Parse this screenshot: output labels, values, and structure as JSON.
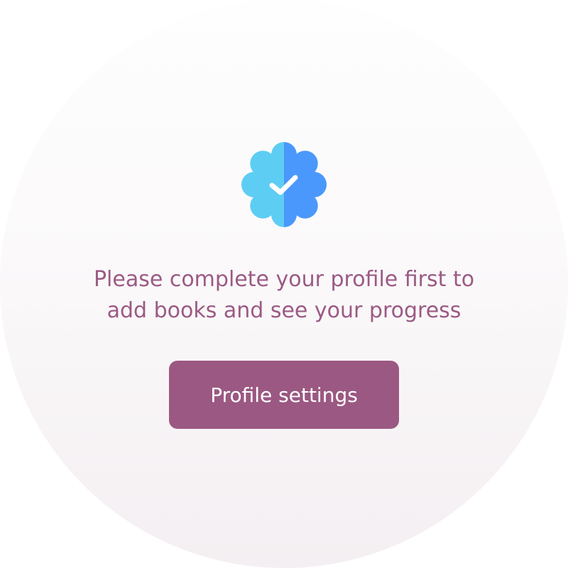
{
  "empty_state": {
    "icon": "verified-badge-icon",
    "message_line_1": "Please complete your profile first to",
    "message_line_2": "add books and see your progress",
    "button_label": "Profile settings"
  },
  "colors": {
    "accent": "#9b5882",
    "text": "#9b5a84",
    "badge_light": "#5ecdf3",
    "badge_dark": "#4a98fb"
  }
}
